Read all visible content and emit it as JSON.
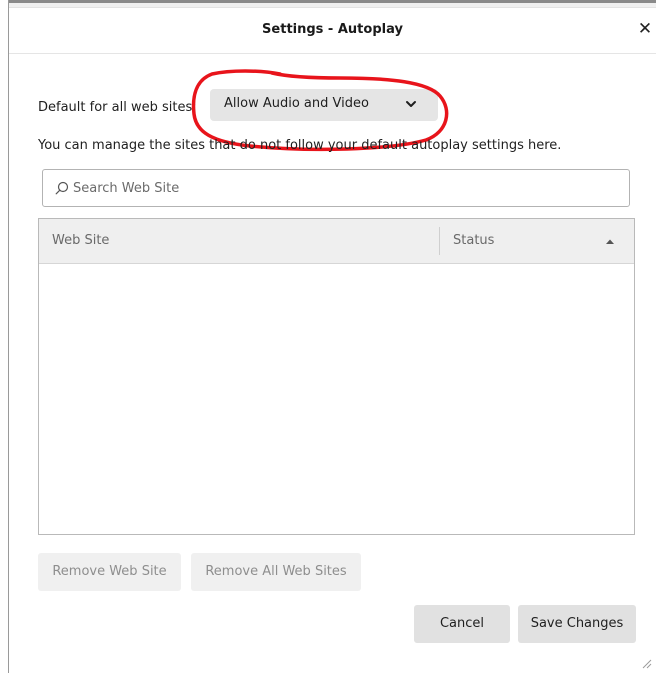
{
  "dialog": {
    "title": "Settings - Autoplay",
    "close_glyph": "✕"
  },
  "default_setting": {
    "label": "Default for all web sites:",
    "selected": "Allow Audio and Video",
    "chevron_icon": "chevron-down-icon"
  },
  "description": "You can manage the sites that do not follow your default autoplay settings here.",
  "search": {
    "placeholder": "Search Web Site",
    "value": "",
    "icon": "search-icon"
  },
  "table": {
    "columns": [
      "Web Site",
      "Status"
    ],
    "sort_column": "Status",
    "sort_direction": "ascending",
    "rows": []
  },
  "buttons": {
    "remove_site": "Remove Web Site",
    "remove_all": "Remove All Web Sites",
    "cancel": "Cancel",
    "save": "Save Changes"
  },
  "colors": {
    "annotation": "#e8141b",
    "button_bg": "#e1e1e1",
    "disabled_text": "#8e8e8e"
  }
}
